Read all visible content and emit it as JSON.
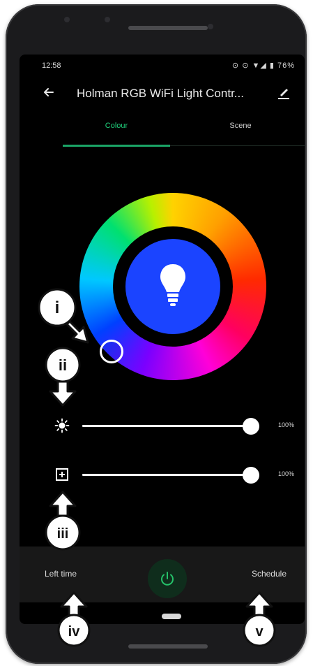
{
  "status_bar": {
    "time": "12:58",
    "icons_text": "⊙ ⊙ ▼◢ ▮ 76%"
  },
  "app_bar": {
    "title": "Holman RGB WiFi Light Contr...",
    "back_icon": "back-arrow-icon",
    "edit_icon": "edit-pencil-icon"
  },
  "tabs": [
    {
      "label": "Colour",
      "selected": true
    },
    {
      "label": "Scene",
      "selected": false
    }
  ],
  "colors": {
    "accent": "#1fcf7b",
    "center": "#1b44ff",
    "background": "#000000"
  },
  "sliders": [
    {
      "name": "brightness",
      "icon": "brightness-icon",
      "value_text": "100%",
      "value": 1.0
    },
    {
      "name": "saturation",
      "icon": "saturation-icon",
      "value_text": "100%",
      "value": 1.0
    }
  ],
  "bottom_bar": {
    "left_label": "Left time",
    "right_label": "Schedule",
    "power_icon": "power-icon"
  },
  "callouts": [
    "i",
    "ii",
    "iii",
    "iv",
    "v"
  ]
}
